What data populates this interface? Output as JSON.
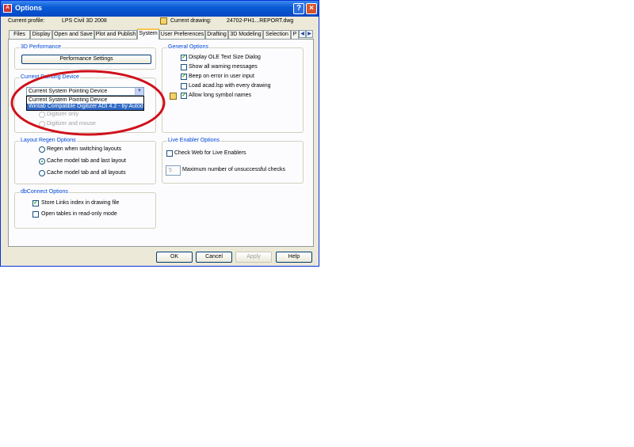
{
  "window": {
    "title": "Options"
  },
  "header": {
    "current_profile_label": "Current profile:",
    "current_profile_value": "LPS Civil 3D 2008",
    "current_drawing_label": "Current drawing:",
    "current_drawing_value": "24702-PH1...REPORT.dwg"
  },
  "tabs": [
    {
      "label": "Files"
    },
    {
      "label": "Display"
    },
    {
      "label": "Open and Save"
    },
    {
      "label": "Plot and Publish"
    },
    {
      "label": "System",
      "active": true
    },
    {
      "label": "User Preferences"
    },
    {
      "label": "Drafting"
    },
    {
      "label": "3D Modeling"
    },
    {
      "label": "Selection"
    },
    {
      "label": "P"
    }
  ],
  "perf": {
    "title": "3D Performance",
    "button": "Performance Settings"
  },
  "pointing": {
    "title": "Current Pointing Device",
    "selected": "Current System Pointing Device",
    "options": [
      "Current System Pointing Device",
      "Wintab Compatible Digitizer ADI 4.2 - by Autodes"
    ],
    "radios": [
      "Digitizer only",
      "Digitizer and mouse"
    ]
  },
  "layout": {
    "title": "Layout Regen Options",
    "options": [
      {
        "label": "Regen when switching layouts",
        "selected": false
      },
      {
        "label": "Cache model tab and last layout",
        "selected": true
      },
      {
        "label": "Cache model tab and all layouts",
        "selected": false
      }
    ]
  },
  "dbconnect": {
    "title": "dbConnect Options",
    "options": [
      {
        "label": "Store Links index in drawing file",
        "checked": true
      },
      {
        "label": "Open tables in read-only mode",
        "checked": false
      }
    ]
  },
  "general": {
    "title": "General Options",
    "options": [
      {
        "label": "Display OLE Text Size Dialog",
        "checked": true
      },
      {
        "label": "Show all warning messages",
        "checked": false
      },
      {
        "label": "Beep on error in user input",
        "checked": true
      },
      {
        "label": "Load acad.lsp with every drawing",
        "checked": false
      },
      {
        "label": "Allow long symbol names",
        "checked": true
      }
    ]
  },
  "live": {
    "title": "Live Enabler Options",
    "check_label": "Check Web for Live Enablers",
    "max_label": "Maximum number of unsuccessful checks",
    "max_value": "5"
  },
  "buttons": {
    "ok": "OK",
    "cancel": "Cancel",
    "apply": "Apply",
    "help": "Help"
  },
  "colors": {
    "annotation_ring": "#d0101a",
    "title_bar": "#0a5bd6",
    "selection": "#316ac5"
  }
}
